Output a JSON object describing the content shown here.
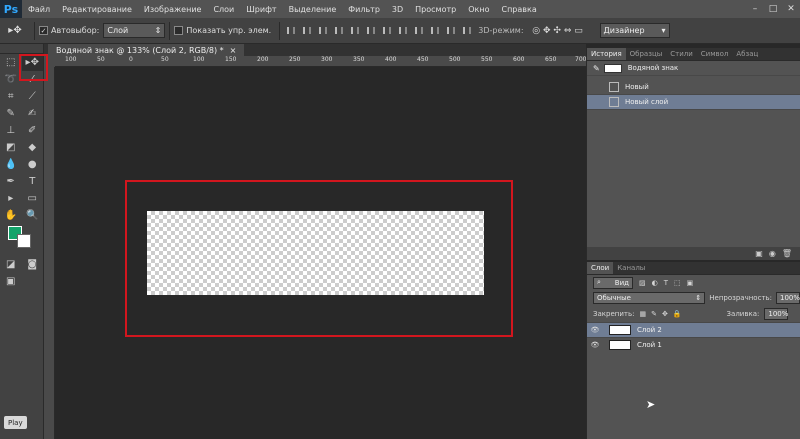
{
  "app": {
    "logo": "Ps"
  },
  "menu": [
    "Файл",
    "Редактирование",
    "Изображение",
    "Слои",
    "Шрифт",
    "Выделение",
    "Фильтр",
    "3D",
    "Просмотр",
    "Окно",
    "Справка"
  ],
  "options": {
    "autoselect_label": "Автовыбор:",
    "autoselect_value": "Слой",
    "show_controls_label": "Показать упр. элем.",
    "mode3d_label": "3D-режим:",
    "workspace_value": "Дизайнер"
  },
  "document": {
    "tab_title": "Водяной знак @ 133% (Слой 2, RGB/8) *"
  },
  "ruler": {
    "top_ticks": [
      "100",
      "50",
      "0",
      "50",
      "100",
      "150",
      "200",
      "250",
      "300",
      "350",
      "400",
      "450",
      "500",
      "550",
      "600",
      "650",
      "700"
    ]
  },
  "history_panel": {
    "tabs": [
      "История",
      "Образцы",
      "Стили",
      "Символ",
      "Абзац"
    ],
    "snapshot_label": "Водяной знак",
    "items": [
      "Новый",
      "Новый слой"
    ]
  },
  "layers_panel": {
    "tabs": [
      "Слои",
      "Каналы"
    ],
    "filter_label": "Вид",
    "blend_mode": "Обычные",
    "opacity_label": "Непрозрачность:",
    "opacity_value": "100%",
    "lock_label": "Закрепить:",
    "fill_label": "Заливка:",
    "fill_value": "100%",
    "layers": [
      "Слой 2",
      "Слой 1"
    ]
  },
  "status": {
    "play_label": "Play"
  },
  "colors": {
    "foreground": "#13a36a",
    "background": "#ffffff",
    "highlight": "#d2161e",
    "selection": "#6f7d94"
  }
}
